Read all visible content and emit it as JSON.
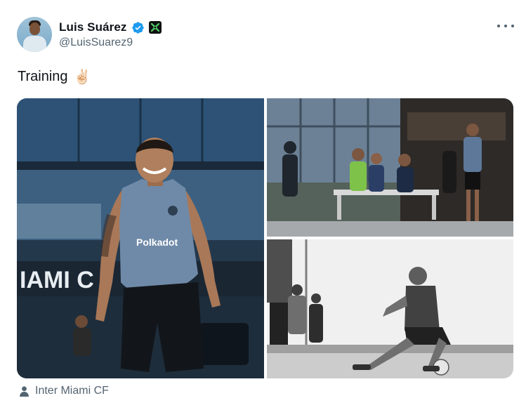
{
  "author": {
    "display_name": "Luis Suárez",
    "handle": "@LuisSuarez9",
    "verified_icon": "verified-badge-icon",
    "affiliate_icon": "inter-miami-affiliate-icon"
  },
  "tweet": {
    "text": "Training",
    "emoji": "✌🏻"
  },
  "media": {
    "images": [
      {
        "name": "training-photo-smiling"
      },
      {
        "name": "training-photo-bench"
      },
      {
        "name": "training-photo-stretching-bw"
      }
    ],
    "photo_texts": {
      "building_sign": "IAMI C",
      "shirt_sponsor": "Polkadot"
    }
  },
  "location": {
    "icon": "person-icon",
    "label": "Inter Miami CF"
  },
  "colors": {
    "verified": "#1d9bf0",
    "muted": "#536471",
    "text": "#0f1419"
  }
}
